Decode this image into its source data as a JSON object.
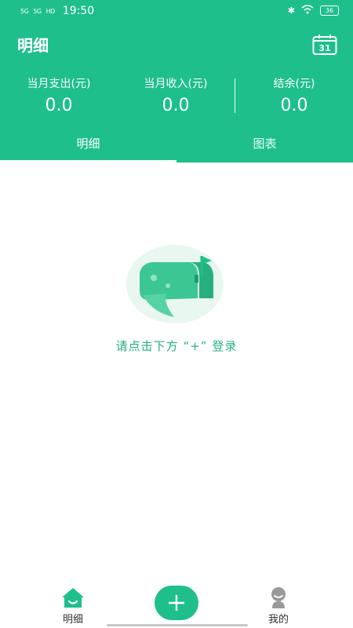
{
  "status_bar": {
    "signal1": "5G",
    "signal2": "5G",
    "hd": "HD",
    "time": "19:50",
    "battery": "36"
  },
  "header": {
    "title": "明细",
    "calendar_day": "31",
    "stats": {
      "expense_label": "当月支出(元)",
      "expense_value": "0.0",
      "income_label": "当月收入(元)",
      "income_value": "0.0",
      "balance_label": "结余(元)",
      "balance_value": "0.0"
    },
    "tabs": [
      {
        "label": "明细",
        "active": true
      },
      {
        "label": "图表",
        "active": false
      }
    ]
  },
  "empty_state": {
    "message": "请点击下方 “+” 登录"
  },
  "bottom_nav": {
    "home_label": "明细",
    "mine_label": "我的",
    "add_icon": "plus-icon"
  },
  "colors": {
    "primary": "#1fbf8b",
    "empty_text": "#27b07f"
  }
}
